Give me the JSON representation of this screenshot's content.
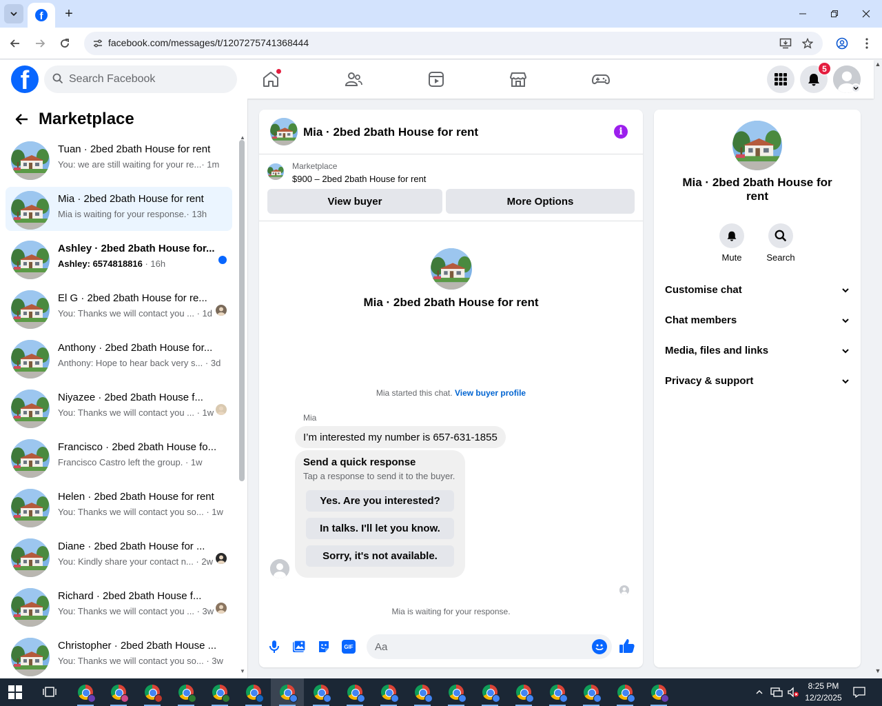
{
  "browser": {
    "url": "facebook.com/messages/t/1207275741368444"
  },
  "header": {
    "search_placeholder": "Search Facebook",
    "notifications_count": "5"
  },
  "sidebar": {
    "title": "Marketplace",
    "conversations": [
      {
        "name": "Tuan · 2bed 2bath House for rent",
        "snippet": "You: we are still waiting for your re...",
        "time": "· 1m",
        "unread": false,
        "active": false,
        "indicator": "none"
      },
      {
        "name": "Mia · 2bed 2bath House for rent",
        "snippet": "Mia is waiting for your response.",
        "time": "· 13h",
        "unread": false,
        "active": true,
        "indicator": "none"
      },
      {
        "name": "Ashley · 2bed 2bath House for...",
        "snippet": "Ashley: 6574818816",
        "time": " · 16h",
        "unread": true,
        "active": false,
        "indicator": "blue-dot"
      },
      {
        "name": "El G · 2bed 2bath House for re...",
        "snippet": "You: Thanks we will contact you ...",
        "time": " · 1d",
        "unread": false,
        "active": false,
        "indicator": "seen-avatar"
      },
      {
        "name": "Anthony · 2bed 2bath House for...",
        "snippet": "Anthony: Hope to hear back very s...",
        "time": " · 3d",
        "unread": false,
        "active": false,
        "indicator": "none"
      },
      {
        "name": "Niyazee · 2bed 2bath House f...",
        "snippet": "You: Thanks we will contact you ...",
        "time": " · 1w",
        "unread": false,
        "active": false,
        "indicator": "seen-avatar"
      },
      {
        "name": "Francisco · 2bed 2bath House fo...",
        "snippet": "Francisco Castro left the group.",
        "time": " · 1w",
        "unread": false,
        "active": false,
        "indicator": "none"
      },
      {
        "name": "Helen · 2bed 2bath House for rent",
        "snippet": "You: Thanks we will contact you so...",
        "time": " · 1w",
        "unread": false,
        "active": false,
        "indicator": "none"
      },
      {
        "name": "Diane · 2bed 2bath House for ...",
        "snippet": "You: Kindly share your contact n...",
        "time": " · 2w",
        "unread": false,
        "active": false,
        "indicator": "seen-avatar"
      },
      {
        "name": "Richard · 2bed 2bath House f...",
        "snippet": "You: Thanks we will contact you ...",
        "time": " · 3w",
        "unread": false,
        "active": false,
        "indicator": "seen-avatar"
      },
      {
        "name": "Christopher · 2bed 2bath House ...",
        "snippet": "You: Thanks we will contact you so...",
        "time": " · 3w",
        "unread": false,
        "active": false,
        "indicator": "none"
      }
    ]
  },
  "chat": {
    "title": "Mia · 2bed 2bath House for rent",
    "listing_source": "Marketplace",
    "listing_price": "$900 – 2bed 2bath House for rent",
    "view_buyer_label": "View buyer",
    "more_options_label": "More Options",
    "profile_name": "Mia · 2bed 2bath House for rent",
    "started_text": "Mia started this chat.",
    "view_profile_link": "View buyer profile",
    "sender_name": "Mia",
    "message": "I’m interested my number is 657-631-1855",
    "quick_title": "Send a quick response",
    "quick_subtitle": "Tap a response to send it to the buyer.",
    "quick_responses": [
      "Yes. Are you interested?",
      "In talks. I'll let you know.",
      "Sorry, it's not available."
    ],
    "waiting_text": "Mia is waiting for your response.",
    "composer_placeholder": "Aa"
  },
  "info_panel": {
    "name": "Mia · 2bed 2bath House for rent",
    "actions": [
      {
        "label": "Mute",
        "icon": "bell-icon"
      },
      {
        "label": "Search",
        "icon": "search-icon"
      }
    ],
    "sections": [
      "Customise chat",
      "Chat members",
      "Media, files and links",
      "Privacy & support"
    ]
  },
  "taskbar": {
    "time": "8:25 PM",
    "date": "12/2/2025"
  },
  "colors": {
    "brand": "#0866ff",
    "active_row": "#ebf5ff",
    "info_button": "#9c1fed",
    "badge": "#e41e3f",
    "link": "#0064d1"
  }
}
